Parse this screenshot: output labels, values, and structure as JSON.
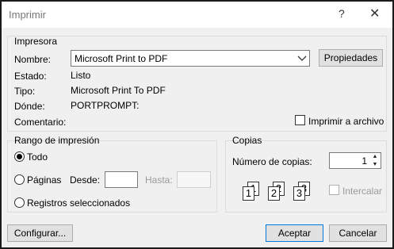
{
  "window": {
    "title": "Imprimir",
    "help_glyph": "?",
    "close_glyph": "✕"
  },
  "printer": {
    "group_title": "Impresora",
    "name_label": "Nombre:",
    "name_value": "Microsoft Print to PDF",
    "properties_button": "Propiedades",
    "status_label": "Estado:",
    "status_value": "Listo",
    "type_label": "Tipo:",
    "type_value": "Microsoft Print To PDF",
    "where_label": "Dónde:",
    "where_value": "PORTPROMPT:",
    "comment_label": "Comentario:",
    "print_to_file_label": "Imprimir a archivo",
    "print_to_file_checked": false
  },
  "range": {
    "group_title": "Rango de impresión",
    "all_label": "Todo",
    "pages_label": "Páginas",
    "from_label": "Desde:",
    "from_value": "",
    "to_label": "Hasta:",
    "to_value": "",
    "selection_label": "Registros seleccionados",
    "selected": "all"
  },
  "copies": {
    "group_title": "Copias",
    "count_label": "Número de copias:",
    "count_value": "1",
    "collate_label": "Intercalar",
    "collate_checked": false,
    "collate_icon": "collate-pages-icon",
    "page_numbers": [
      "1",
      "1",
      "2",
      "2",
      "3",
      "3"
    ]
  },
  "buttons": {
    "setup": "Configurar...",
    "ok": "Aceptar",
    "cancel": "Cancelar"
  }
}
